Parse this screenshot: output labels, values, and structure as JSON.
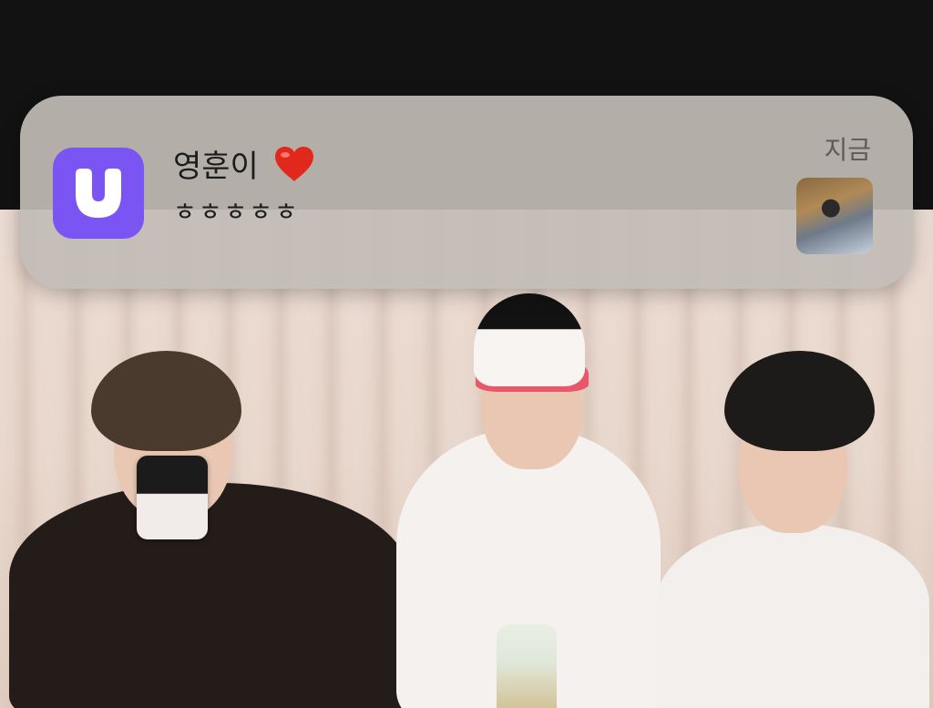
{
  "notification": {
    "app_name": "Weverse",
    "app_icon": "weverse-u-icon",
    "sender": "영훈이",
    "sender_emoji": "heart-emoji",
    "message": "ㅎㅎㅎㅎㅎ",
    "timestamp": "지금",
    "accent_color": "#7b55f3"
  },
  "background": {
    "content": "live-video-stream",
    "top_bar_color": "#121212"
  }
}
